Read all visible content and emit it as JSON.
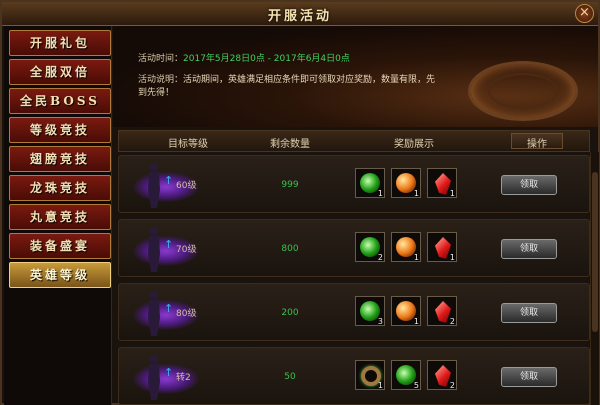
{
  "window": {
    "title": "开服活动",
    "close_icon": "×"
  },
  "sidebar": {
    "items": [
      {
        "label": "开服礼包"
      },
      {
        "label": "全服双倍"
      },
      {
        "label": "全民BOSS"
      },
      {
        "label": "等级竞技"
      },
      {
        "label": "翅膀竞技"
      },
      {
        "label": "龙珠竞技"
      },
      {
        "label": "丸意竞技"
      },
      {
        "label": "装备盛宴"
      },
      {
        "label": "英雄等级",
        "active": true
      }
    ]
  },
  "info": {
    "time_label": "活动时间：",
    "time_value": "2017年5月28日0点 - 2017年6月4日0点",
    "desc_label": "活动说明：",
    "desc_value": "活动期间，英雄满足相应条件即可领取对应奖励，数量有限，先到先得！"
  },
  "table": {
    "headers": {
      "target": "目标等级",
      "remain": "剩余数量",
      "rewards": "奖励展示",
      "action": "操作"
    },
    "rows": [
      {
        "level": "60级",
        "remain": "999",
        "rewards": [
          {
            "icon": "green-orb-icon",
            "count": "1"
          },
          {
            "icon": "orange-orb-icon",
            "count": "1"
          },
          {
            "icon": "red-crystal-icon",
            "count": "1"
          }
        ],
        "button": "领取"
      },
      {
        "level": "70级",
        "remain": "800",
        "rewards": [
          {
            "icon": "green-orb-icon",
            "count": "2"
          },
          {
            "icon": "orange-orb-icon",
            "count": "1"
          },
          {
            "icon": "red-crystal-icon",
            "count": "1"
          }
        ],
        "button": "领取"
      },
      {
        "level": "80级",
        "remain": "200",
        "rewards": [
          {
            "icon": "green-orb-icon",
            "count": "3"
          },
          {
            "icon": "orange-orb-icon",
            "count": "1"
          },
          {
            "icon": "red-crystal-icon",
            "count": "2"
          }
        ],
        "button": "领取"
      },
      {
        "level": "转2",
        "remain": "50",
        "rewards": [
          {
            "icon": "gold-ring-icon",
            "count": "1"
          },
          {
            "icon": "green-orb-icon",
            "count": "5"
          },
          {
            "icon": "red-crystal-icon",
            "count": "2"
          }
        ],
        "button": "领取"
      }
    ]
  },
  "colors": {
    "accent": "#42d060",
    "frame": "#4a3420",
    "active_tab": "#c89a3a"
  }
}
